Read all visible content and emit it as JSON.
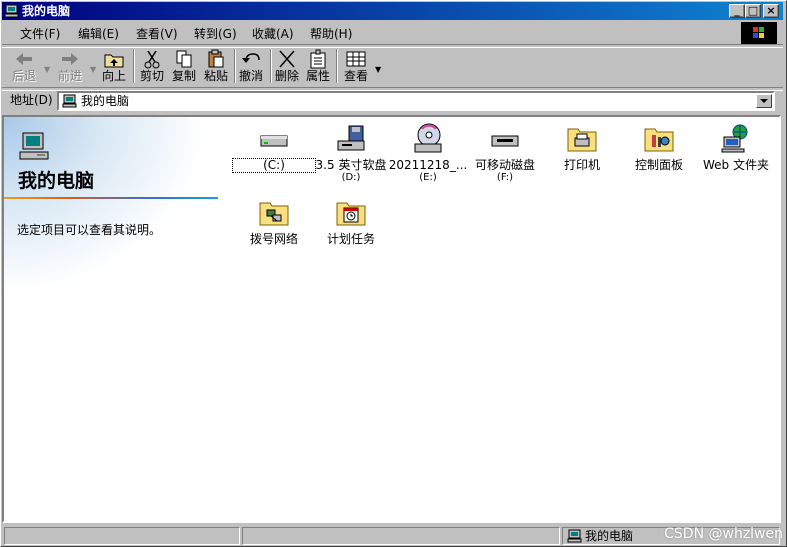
{
  "window": {
    "title": "我的电脑"
  },
  "menu": [
    {
      "label": "文件(F)"
    },
    {
      "label": "编辑(E)"
    },
    {
      "label": "查看(V)"
    },
    {
      "label": "转到(G)"
    },
    {
      "label": "收藏(A)"
    },
    {
      "label": "帮助(H)"
    }
  ],
  "toolbar": {
    "back": "后退",
    "forward": "前进",
    "up": "向上",
    "cut": "剪切",
    "copy": "复制",
    "paste": "粘贴",
    "undo": "撤消",
    "delete": "删除",
    "properties": "属性",
    "view": "查看"
  },
  "address": {
    "label": "地址(D)",
    "value": "我的电脑"
  },
  "leftpane": {
    "title": "我的电脑",
    "description": "选定项目可以查看其说明。"
  },
  "items": [
    {
      "label": "(C:)",
      "sub": ""
    },
    {
      "label": "3.5 英寸软盘",
      "sub": "(D:)"
    },
    {
      "label": "20211218_...",
      "sub": "(E:)"
    },
    {
      "label": "可移动磁盘",
      "sub": "(F:)"
    },
    {
      "label": "打印机",
      "sub": ""
    },
    {
      "label": "控制面板",
      "sub": ""
    },
    {
      "label": "Web 文件夹",
      "sub": ""
    },
    {
      "label": "拨号网络",
      "sub": ""
    },
    {
      "label": "计划任务",
      "sub": ""
    }
  ],
  "status": {
    "location": "我的电脑"
  },
  "watermark": "CSDN @whzlwen"
}
